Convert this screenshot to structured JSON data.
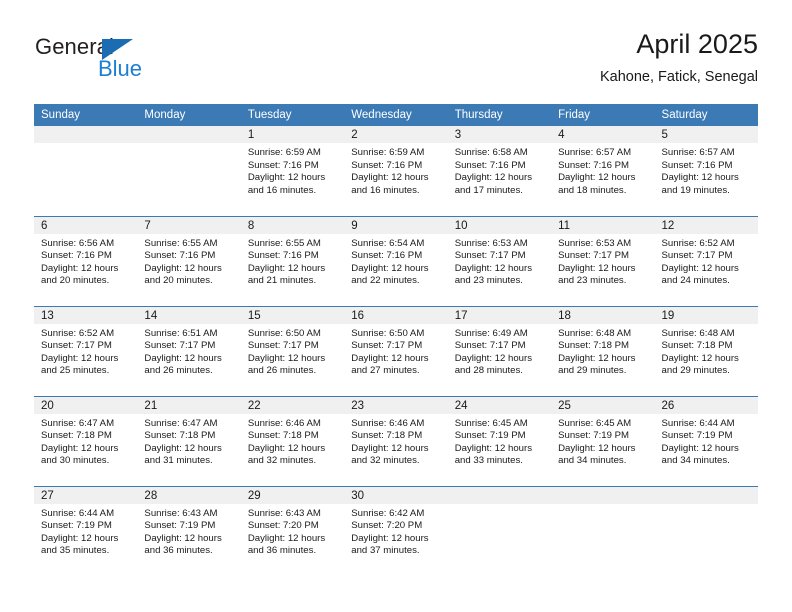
{
  "brand": {
    "name_top": "General",
    "name_bottom": "Blue",
    "triangle_color": "#1b6cb3",
    "blue_text_color": "#1b7fd4"
  },
  "header": {
    "title": "April 2025",
    "subtitle": "Kahone, Fatick, Senegal"
  },
  "colors": {
    "header_blue": "#3b7ab5",
    "band_grey": "#f0f0f0",
    "text": "#1a1a1a"
  },
  "weekdays": [
    "Sunday",
    "Monday",
    "Tuesday",
    "Wednesday",
    "Thursday",
    "Friday",
    "Saturday"
  ],
  "weeks": [
    [
      {
        "day": "",
        "sunrise": "",
        "sunset": "",
        "daylight1": "",
        "daylight2": ""
      },
      {
        "day": "",
        "sunrise": "",
        "sunset": "",
        "daylight1": "",
        "daylight2": ""
      },
      {
        "day": "1",
        "sunrise": "Sunrise: 6:59 AM",
        "sunset": "Sunset: 7:16 PM",
        "daylight1": "Daylight: 12 hours",
        "daylight2": "and 16 minutes."
      },
      {
        "day": "2",
        "sunrise": "Sunrise: 6:59 AM",
        "sunset": "Sunset: 7:16 PM",
        "daylight1": "Daylight: 12 hours",
        "daylight2": "and 16 minutes."
      },
      {
        "day": "3",
        "sunrise": "Sunrise: 6:58 AM",
        "sunset": "Sunset: 7:16 PM",
        "daylight1": "Daylight: 12 hours",
        "daylight2": "and 17 minutes."
      },
      {
        "day": "4",
        "sunrise": "Sunrise: 6:57 AM",
        "sunset": "Sunset: 7:16 PM",
        "daylight1": "Daylight: 12 hours",
        "daylight2": "and 18 minutes."
      },
      {
        "day": "5",
        "sunrise": "Sunrise: 6:57 AM",
        "sunset": "Sunset: 7:16 PM",
        "daylight1": "Daylight: 12 hours",
        "daylight2": "and 19 minutes."
      }
    ],
    [
      {
        "day": "6",
        "sunrise": "Sunrise: 6:56 AM",
        "sunset": "Sunset: 7:16 PM",
        "daylight1": "Daylight: 12 hours",
        "daylight2": "and 20 minutes."
      },
      {
        "day": "7",
        "sunrise": "Sunrise: 6:55 AM",
        "sunset": "Sunset: 7:16 PM",
        "daylight1": "Daylight: 12 hours",
        "daylight2": "and 20 minutes."
      },
      {
        "day": "8",
        "sunrise": "Sunrise: 6:55 AM",
        "sunset": "Sunset: 7:16 PM",
        "daylight1": "Daylight: 12 hours",
        "daylight2": "and 21 minutes."
      },
      {
        "day": "9",
        "sunrise": "Sunrise: 6:54 AM",
        "sunset": "Sunset: 7:16 PM",
        "daylight1": "Daylight: 12 hours",
        "daylight2": "and 22 minutes."
      },
      {
        "day": "10",
        "sunrise": "Sunrise: 6:53 AM",
        "sunset": "Sunset: 7:17 PM",
        "daylight1": "Daylight: 12 hours",
        "daylight2": "and 23 minutes."
      },
      {
        "day": "11",
        "sunrise": "Sunrise: 6:53 AM",
        "sunset": "Sunset: 7:17 PM",
        "daylight1": "Daylight: 12 hours",
        "daylight2": "and 23 minutes."
      },
      {
        "day": "12",
        "sunrise": "Sunrise: 6:52 AM",
        "sunset": "Sunset: 7:17 PM",
        "daylight1": "Daylight: 12 hours",
        "daylight2": "and 24 minutes."
      }
    ],
    [
      {
        "day": "13",
        "sunrise": "Sunrise: 6:52 AM",
        "sunset": "Sunset: 7:17 PM",
        "daylight1": "Daylight: 12 hours",
        "daylight2": "and 25 minutes."
      },
      {
        "day": "14",
        "sunrise": "Sunrise: 6:51 AM",
        "sunset": "Sunset: 7:17 PM",
        "daylight1": "Daylight: 12 hours",
        "daylight2": "and 26 minutes."
      },
      {
        "day": "15",
        "sunrise": "Sunrise: 6:50 AM",
        "sunset": "Sunset: 7:17 PM",
        "daylight1": "Daylight: 12 hours",
        "daylight2": "and 26 minutes."
      },
      {
        "day": "16",
        "sunrise": "Sunrise: 6:50 AM",
        "sunset": "Sunset: 7:17 PM",
        "daylight1": "Daylight: 12 hours",
        "daylight2": "and 27 minutes."
      },
      {
        "day": "17",
        "sunrise": "Sunrise: 6:49 AM",
        "sunset": "Sunset: 7:17 PM",
        "daylight1": "Daylight: 12 hours",
        "daylight2": "and 28 minutes."
      },
      {
        "day": "18",
        "sunrise": "Sunrise: 6:48 AM",
        "sunset": "Sunset: 7:18 PM",
        "daylight1": "Daylight: 12 hours",
        "daylight2": "and 29 minutes."
      },
      {
        "day": "19",
        "sunrise": "Sunrise: 6:48 AM",
        "sunset": "Sunset: 7:18 PM",
        "daylight1": "Daylight: 12 hours",
        "daylight2": "and 29 minutes."
      }
    ],
    [
      {
        "day": "20",
        "sunrise": "Sunrise: 6:47 AM",
        "sunset": "Sunset: 7:18 PM",
        "daylight1": "Daylight: 12 hours",
        "daylight2": "and 30 minutes."
      },
      {
        "day": "21",
        "sunrise": "Sunrise: 6:47 AM",
        "sunset": "Sunset: 7:18 PM",
        "daylight1": "Daylight: 12 hours",
        "daylight2": "and 31 minutes."
      },
      {
        "day": "22",
        "sunrise": "Sunrise: 6:46 AM",
        "sunset": "Sunset: 7:18 PM",
        "daylight1": "Daylight: 12 hours",
        "daylight2": "and 32 minutes."
      },
      {
        "day": "23",
        "sunrise": "Sunrise: 6:46 AM",
        "sunset": "Sunset: 7:18 PM",
        "daylight1": "Daylight: 12 hours",
        "daylight2": "and 32 minutes."
      },
      {
        "day": "24",
        "sunrise": "Sunrise: 6:45 AM",
        "sunset": "Sunset: 7:19 PM",
        "daylight1": "Daylight: 12 hours",
        "daylight2": "and 33 minutes."
      },
      {
        "day": "25",
        "sunrise": "Sunrise: 6:45 AM",
        "sunset": "Sunset: 7:19 PM",
        "daylight1": "Daylight: 12 hours",
        "daylight2": "and 34 minutes."
      },
      {
        "day": "26",
        "sunrise": "Sunrise: 6:44 AM",
        "sunset": "Sunset: 7:19 PM",
        "daylight1": "Daylight: 12 hours",
        "daylight2": "and 34 minutes."
      }
    ],
    [
      {
        "day": "27",
        "sunrise": "Sunrise: 6:44 AM",
        "sunset": "Sunset: 7:19 PM",
        "daylight1": "Daylight: 12 hours",
        "daylight2": "and 35 minutes."
      },
      {
        "day": "28",
        "sunrise": "Sunrise: 6:43 AM",
        "sunset": "Sunset: 7:19 PM",
        "daylight1": "Daylight: 12 hours",
        "daylight2": "and 36 minutes."
      },
      {
        "day": "29",
        "sunrise": "Sunrise: 6:43 AM",
        "sunset": "Sunset: 7:20 PM",
        "daylight1": "Daylight: 12 hours",
        "daylight2": "and 36 minutes."
      },
      {
        "day": "30",
        "sunrise": "Sunrise: 6:42 AM",
        "sunset": "Sunset: 7:20 PM",
        "daylight1": "Daylight: 12 hours",
        "daylight2": "and 37 minutes."
      },
      {
        "day": "",
        "sunrise": "",
        "sunset": "",
        "daylight1": "",
        "daylight2": ""
      },
      {
        "day": "",
        "sunrise": "",
        "sunset": "",
        "daylight1": "",
        "daylight2": ""
      },
      {
        "day": "",
        "sunrise": "",
        "sunset": "",
        "daylight1": "",
        "daylight2": ""
      }
    ]
  ]
}
